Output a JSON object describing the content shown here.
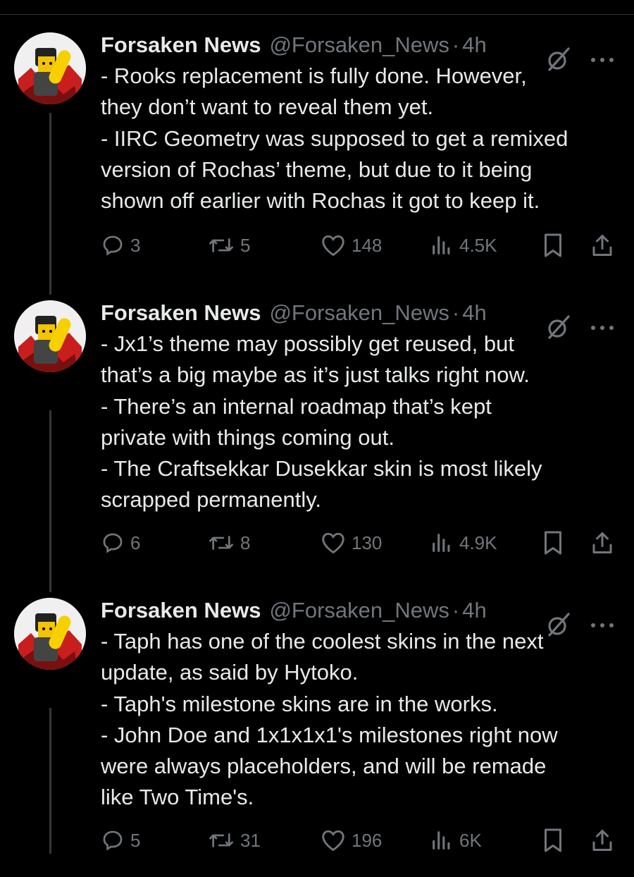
{
  "tweets": [
    {
      "author": "Forsaken News",
      "handle": "@Forsaken_News",
      "dot": "·",
      "time": "4h",
      "lines": [
        "- Rooks replacement is fully done. However,",
        "they don’t want to reveal them yet.",
        "- IIRC Geometry was supposed to get a remixed",
        "version of Rochas’ theme, but due to it being",
        "shown off earlier with Rochas it got to keep it."
      ],
      "replies": "3",
      "reposts": "5",
      "likes": "148",
      "views": "4.5K"
    },
    {
      "author": "Forsaken News",
      "handle": "@Forsaken_News",
      "dot": "·",
      "time": "4h",
      "lines": [
        "- Jx1’s theme may possibly get reused, but",
        "that’s a big maybe as it’s just talks right now.",
        "- There’s an internal roadmap that’s kept",
        "private with things coming out.",
        "- The Craftsekkar Dusekkar skin is most likely",
        "scrapped permanently."
      ],
      "replies": "6",
      "reposts": "8",
      "likes": "130",
      "views": "4.9K"
    },
    {
      "author": "Forsaken News",
      "handle": "@Forsaken_News",
      "dot": "·",
      "time": "4h",
      "lines": [
        "- Taph has one of the coolest skins in the next",
        "update, as said by Hytoko.",
        "- Taph's milestone skins are in the works.",
        "- John Doe and 1x1x1x1's milestones right now",
        "were always placeholders, and will be remade",
        "like Two Time's."
      ],
      "replies": "5",
      "reposts": "31",
      "likes": "196",
      "views": "6K"
    }
  ],
  "icons": [
    "reply-icon",
    "repost-icon",
    "like-icon",
    "views-icon",
    "bookmark-icon",
    "share-icon",
    "grok-icon",
    "more-icon"
  ],
  "colors": {
    "background": "#000000",
    "text": "#e7e9ea",
    "muted": "#71767b",
    "divider": "#2f3336"
  }
}
